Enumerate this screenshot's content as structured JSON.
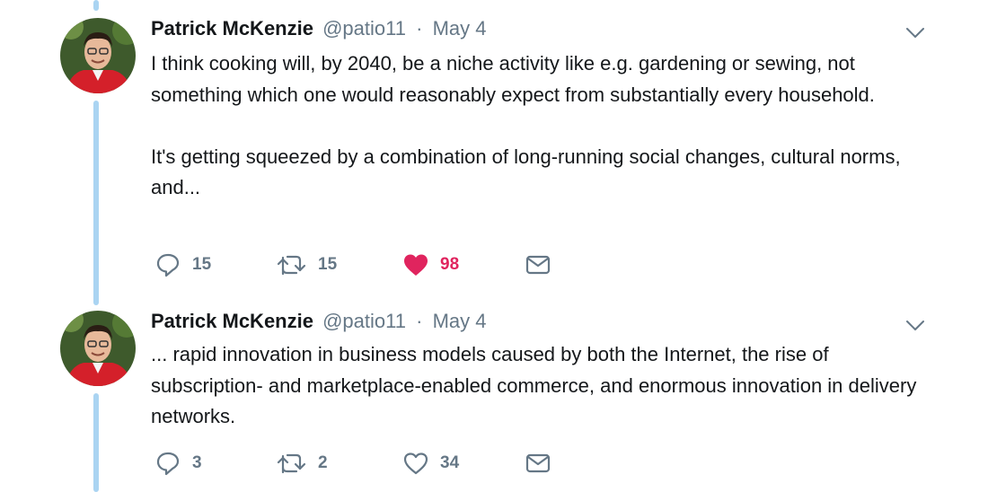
{
  "tweets": [
    {
      "author_name": "Patrick McKenzie",
      "handle": "@patio11",
      "separator": "·",
      "date": "May 4",
      "text": "I think cooking will, by 2040, be a niche activity like e.g. gardening or sewing, not something which one would reasonably expect from substantially every household.\n\nIt's getting squeezed by a combination of long-running social changes, cultural norms, and...",
      "replies": "15",
      "retweets": "15",
      "likes": "98",
      "liked": true,
      "icons": [
        "reply-icon",
        "retweet-icon",
        "heart-filled-icon",
        "envelope-icon",
        "chevron-down-icon"
      ]
    },
    {
      "author_name": "Patrick McKenzie",
      "handle": "@patio11",
      "separator": "·",
      "date": "May 4",
      "text": "... rapid innovation in business models caused by both the Internet, the rise of subscription- and marketplace-enabled commerce, and enormous innovation in delivery networks.",
      "replies": "3",
      "retweets": "2",
      "likes": "34",
      "liked": false,
      "icons": [
        "reply-icon",
        "retweet-icon",
        "heart-outline-icon",
        "envelope-icon",
        "chevron-down-icon"
      ]
    }
  ],
  "colors": {
    "thread_line": "#aad4f2",
    "secondary_text": "#657786",
    "like_red": "#e0245e",
    "primary_text": "#14171a"
  }
}
